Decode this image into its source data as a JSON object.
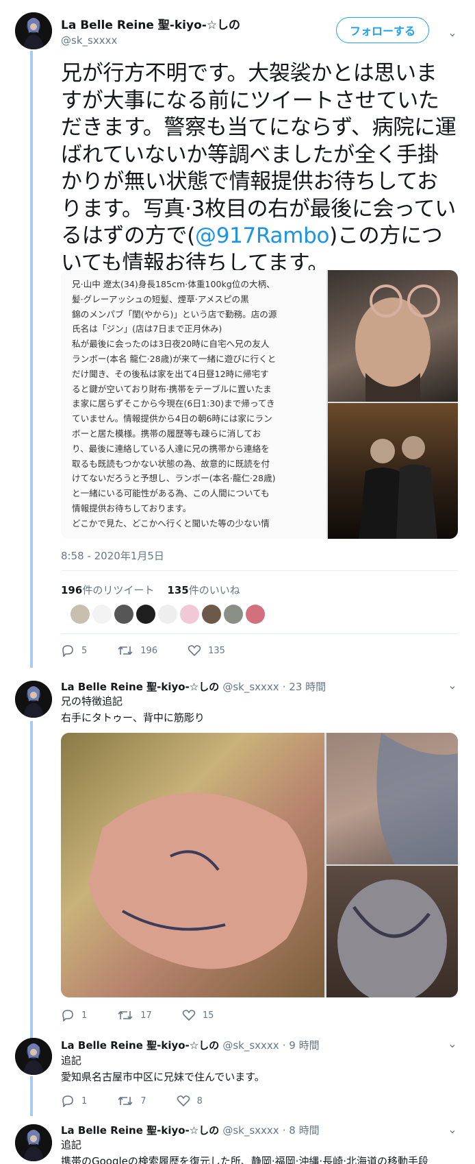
{
  "main_tweet": {
    "display_name": "La Belle Reine 聖-kiyo-☆しの",
    "handle": "@sk_sxxxx",
    "follow_label": "フォローする",
    "text_before_mention": "兄が行方不明です。大袈裟かとは思いますが大事になる前にツイートさせていただきます。警察も当てにならず、病院に運ばれていないか等調べましたが全く手掛かりが無い状態で情報提供お待ちしております。写真·3枚目の右が最後に会っているはずの方で(",
    "mention": "@917Rambo",
    "text_after_mention": ")この方についても情報お待ちしてます。",
    "note_lines": [
      "兄·山中 遼太(34)身長185cm·体重100kg位の大柄、",
      "髪·グレーアッシュの短髪、煙草·アメスピの黒",
      "錦のメンパブ「閨(やから)」という店で勤務。店の源",
      "氏名は「ジン」(店は7日まで正月休み)",
      "私が最後に会ったのは3日夜20時に自宅へ兄の友人",
      "ランボー(本名 龍仁·28歳)が来て一緒に遊びに行くと",
      "だけ聞き、その後私は家を出て4日昼12時に帰宅す",
      "ると鍵が空いており財布·携帯をテーブルに置いたま",
      "ま家に居らずそこから今現在(6日1:30)まで帰ってき",
      "ていません。情報提供から4日の朝6時には家にラン",
      "ボーと居た模様。携帯の履歴等も疎らに消してお",
      "り、最後に連絡している人達に兄の携帯から連絡を",
      "取るも既読もつかない状態の為、故意的に既読を付",
      "けてないだろうと予想し、ランボー(本名·龍仁·28歳)",
      "と一緒にいる可能性がある為、この人間についても",
      "情報提供お待ちしております。",
      "どこかで見た、どこかへ行くと聞いた等の少ない情"
    ],
    "timestamp": "8:58 - 2020年1月5日",
    "retweet_count": "196",
    "retweet_label": "件のリツイート",
    "like_count": "135",
    "like_label": "件のいいね",
    "actions": {
      "replies": "5",
      "retweets": "196",
      "likes": "135"
    }
  },
  "replies": [
    {
      "display_name": "La Belle Reine 聖-kiyo-☆しの",
      "handle": "@sk_sxxxx",
      "time": "· 23 時間",
      "line1": "兄の特徴追記",
      "line2": "右手にタトゥー、背中に筋彫り",
      "actions": {
        "replies": "1",
        "retweets": "17",
        "likes": "15"
      }
    },
    {
      "display_name": "La Belle Reine 聖-kiyo-☆しの",
      "handle": "@sk_sxxxx",
      "time": "· 9 時間",
      "line1": "追記",
      "line2": "愛知県名古屋市中区に兄妹で住んでいます。",
      "actions": {
        "replies": "1",
        "retweets": "7",
        "likes": "8"
      }
    },
    {
      "display_name": "La Belle Reine 聖-kiyo-☆しの",
      "handle": "@sk_sxxxx",
      "time": "· 8 時間",
      "line1": "追記",
      "line2": "携帯のGoogleの検索履歴を復元した所、静岡·福岡·沖縄·長崎·北海道の移動手段"
    }
  ],
  "colors": {
    "accent": "#1da1f2",
    "thread": "#a6cdef",
    "muted": "#657786"
  }
}
